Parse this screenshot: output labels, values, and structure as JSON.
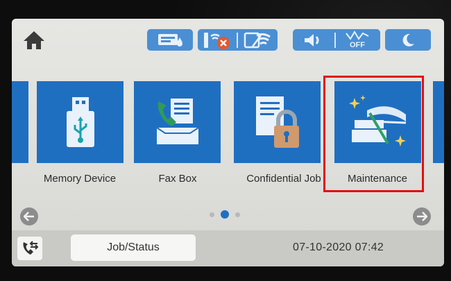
{
  "top_bar": {
    "home_icon": "home-icon",
    "status_icons": [
      "ink-status-icon",
      "wifi-direct-error-icon",
      "wifi-icon",
      "volume-icon",
      "quiet-mode-off-icon",
      "sleep-moon-icon"
    ],
    "quiet_mode_text": "OFF"
  },
  "apps": [
    {
      "label": "Memory Device",
      "icon": "usb-memory-icon"
    },
    {
      "label": "Fax Box",
      "icon": "fax-box-icon"
    },
    {
      "label": "Confidential Job",
      "icon": "confidential-job-lock-icon"
    },
    {
      "label": "Maintenance",
      "icon": "maintenance-icon"
    }
  ],
  "pagination": {
    "pages": 3,
    "current": 2
  },
  "bottom_bar": {
    "fax_icon": "fax-send-receive-icon",
    "job_status_label": "Job/Status",
    "datetime": "07-10-2020 07:42"
  },
  "colors": {
    "tile_blue": "#1f6fc1",
    "status_blue": "#4a8fd4",
    "highlight_red": "#e01010"
  }
}
